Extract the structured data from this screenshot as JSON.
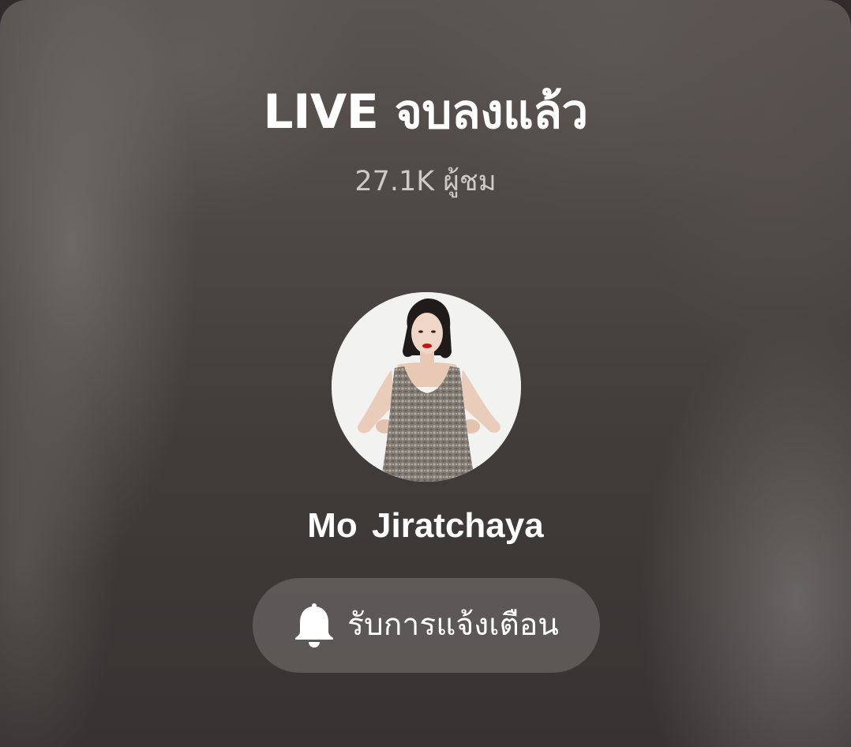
{
  "live_status": {
    "title": "LIVE จบลงแล้ว",
    "viewers": "27.1K ผู้ชม"
  },
  "host": {
    "name": "Mo  Jiratchaya",
    "avatar_icon": "profile-photo"
  },
  "notify_button": {
    "icon": "bell-icon",
    "label": "รับการแจ้งเตือน"
  },
  "colors": {
    "text_primary": "#ffffff",
    "text_secondary": "#cfcac7",
    "button_bg": "rgba(120,116,114,0.55)"
  }
}
